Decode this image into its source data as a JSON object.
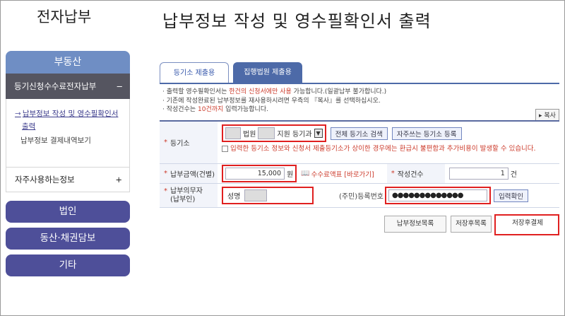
{
  "brand": "전자납부",
  "page_title": "납부정보 작성 및 영수필확인서 출력",
  "sidebar": {
    "header": "부동산",
    "section": {
      "label": "등기신청수수료전자납부",
      "toggle": "−"
    },
    "subitems": [
      "납부정보 작성 및 영수필확인서",
      "출력",
      "납부정보 결제내역보기"
    ],
    "frequent": {
      "label": "자주사용하는정보",
      "toggle": "+"
    },
    "buttons": [
      "법인",
      "동산·채권담보",
      "기타"
    ]
  },
  "tabs": [
    "등기소 제출용",
    "집행법원 제출용"
  ],
  "notes": {
    "n1a": "출력할 영수필확인서는 ",
    "n1b": "한건의 신청서에만 사용",
    "n1c": " 가능합니다.(일괄납부 불가합니다.)",
    "n2": "기존에 작성완료된 납부정보를 재사용하시려면 우측의 『복사』를 선택하십시오.",
    "n3a": "작성건수는 ",
    "n3b": "10건까지",
    "n3c": " 입력가능합니다."
  },
  "copy_button": "복사",
  "form": {
    "registry": {
      "label": "등기소",
      "court": "법원",
      "branch": "지원 등기과",
      "search_all": "전체 등기소 검색",
      "register_favorite": "자주쓰는 등기소 등록",
      "warning": "입력한 등기소 정보와 신청서 제출등기소가 상이한 경우에는 환급시 불편함과 추가비용이 발생할 수 있습니다."
    },
    "amount": {
      "label": "납부금액(건별)",
      "value": "15,000",
      "unit": "원",
      "fee_table": "수수료액표 [바로가기]"
    },
    "count": {
      "label": "작성건수",
      "value": "1",
      "unit": "건"
    },
    "payer": {
      "label_1": "납부의무자",
      "label_2": "(납부인)",
      "name_label": "성명",
      "id_label": "(주민)등록번호",
      "id_mask": "●●●●●●●●●●●●●",
      "confirm": "입력확인"
    }
  },
  "bottom_buttons": [
    "납부정보목록",
    "저장후목록",
    "저장후결제"
  ]
}
